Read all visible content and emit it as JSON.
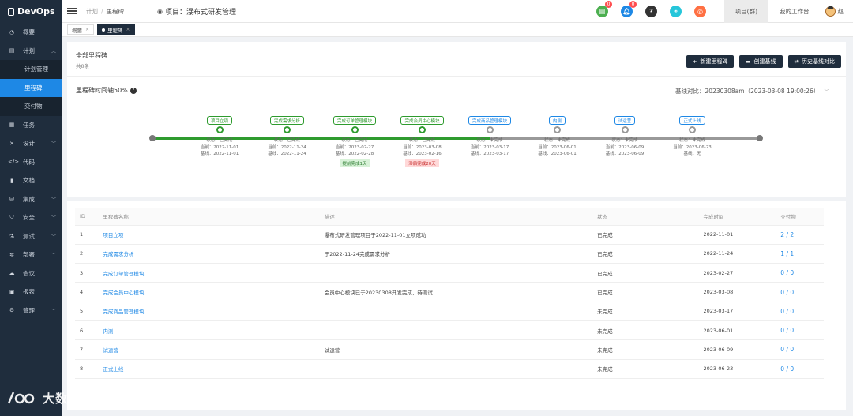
{
  "app": {
    "logo": "DevOps"
  },
  "sidebar": {
    "items": [
      {
        "icon": "dashboard-icon",
        "glyph": "◔",
        "label": "概要",
        "chev": false
      },
      {
        "icon": "plan-icon",
        "glyph": "▤",
        "label": "计划",
        "chev": true,
        "chev_dir": "up"
      },
      {
        "label": "计划管理",
        "sub": true
      },
      {
        "label": "里程碑",
        "sub": true,
        "active": true
      },
      {
        "label": "交付物",
        "sub": true
      },
      {
        "icon": "task-icon",
        "glyph": "▦",
        "label": "任务",
        "chev": false
      },
      {
        "icon": "design-icon",
        "glyph": "✕",
        "label": "设计",
        "chev": true
      },
      {
        "icon": "code-icon",
        "glyph": "</>",
        "label": "代码",
        "chev": false
      },
      {
        "icon": "doc-icon",
        "glyph": "▮",
        "label": "文档",
        "chev": false
      },
      {
        "icon": "integration-icon",
        "glyph": "⛁",
        "label": "集成",
        "chev": true
      },
      {
        "icon": "security-icon",
        "glyph": "⛉",
        "label": "安全",
        "chev": true
      },
      {
        "icon": "test-icon",
        "glyph": "⚗",
        "label": "测试",
        "chev": true
      },
      {
        "icon": "deploy-icon",
        "glyph": "✲",
        "label": "部署",
        "chev": true
      },
      {
        "icon": "meeting-icon",
        "glyph": "☁",
        "label": "会议",
        "chev": false
      },
      {
        "icon": "report-icon",
        "glyph": "▣",
        "label": "报表",
        "chev": false
      },
      {
        "icon": "admin-icon",
        "glyph": "⚙",
        "label": "管理",
        "chev": true
      }
    ]
  },
  "header": {
    "breadcrumb": [
      "计划",
      "里程碑"
    ],
    "project_prefix": "项目：",
    "project_name": "瀑布式研发管理",
    "icons": [
      {
        "name": "todo-icon",
        "color": "#4caf50",
        "glyph": "▤",
        "badge": "0"
      },
      {
        "name": "notification-bell-icon",
        "color": "#1e88e5",
        "glyph": "🔔︎",
        "badge": "0"
      },
      {
        "name": "help-icon",
        "color": "#333333",
        "glyph": "?",
        "badge": ""
      },
      {
        "name": "link-icon",
        "color": "#26c6da",
        "glyph": "⚭",
        "badge": ""
      },
      {
        "name": "settings-icon",
        "color": "#ff7043",
        "glyph": "◎",
        "badge": ""
      }
    ],
    "tabs": [
      {
        "label": "项目(群)",
        "active": true
      },
      {
        "label": "我的工作台",
        "active": false
      }
    ],
    "user": "赵"
  },
  "tabs_bar": [
    {
      "label": "概要",
      "active": false
    },
    {
      "label": "里程碑",
      "active": true
    }
  ],
  "milestones_card": {
    "title": "全部里程碑",
    "count": "共8条",
    "buttons": [
      {
        "icon": "plus-icon",
        "glyph": "+",
        "label": "新建里程碑"
      },
      {
        "icon": "baseline-icon",
        "glyph": "▬",
        "label": "创建基线"
      },
      {
        "icon": "history-icon",
        "glyph": "⇄",
        "label": "历史基线对比"
      }
    ],
    "timeline_title": "里程碑时间轴50%",
    "baseline_compare": "基线对比：20230308am（2023-03-08 19:00:26）",
    "colors": {
      "done": "#2e9b2e",
      "todo": "#1e88e5",
      "track_gray": "#999999"
    }
  },
  "timeline": [
    {
      "label": "项目立项",
      "done": true,
      "status": "状态：已完成",
      "current": "当前：2022-11-01",
      "base": "基线：2022-11-01",
      "flag": "",
      "flag_type": ""
    },
    {
      "label": "完成需求分析",
      "done": true,
      "status": "状态：已完成",
      "current": "当前：2022-11-24",
      "base": "基线：2022-11-24",
      "flag": "",
      "flag_type": ""
    },
    {
      "label": "完成订单管理模块",
      "done": true,
      "status": "状态：已完成",
      "current": "当前：2023-02-27",
      "base": "基线：2022-02-28",
      "flag": "提前完成1天",
      "flag_type": "green"
    },
    {
      "label": "完成会员中心模块",
      "done": true,
      "status": "状态：已完成",
      "current": "当前：2023-03-08",
      "base": "基线：2023-02-16",
      "flag": "滞后完成20天",
      "flag_type": "red"
    },
    {
      "label": "完成商品管理模块",
      "done": false,
      "status": "状态：未完成",
      "current": "当前：2023-03-17",
      "base": "基线：2023-03-17",
      "flag": "",
      "flag_type": ""
    },
    {
      "label": "内测",
      "done": false,
      "status": "状态：未完成",
      "current": "当前：2023-06-01",
      "base": "基线：2023-06-01",
      "flag": "",
      "flag_type": ""
    },
    {
      "label": "试运营",
      "done": false,
      "status": "状态：未完成",
      "current": "当前：2023-06-09",
      "base": "基线：2023-06-09",
      "flag": "",
      "flag_type": ""
    },
    {
      "label": "正式上线",
      "done": false,
      "status": "状态：未完成",
      "current": "当前：2023-06-23",
      "base": "基线：无",
      "flag": "",
      "flag_type": ""
    }
  ],
  "table": {
    "headers": [
      "ID",
      "里程碑名称",
      "描述",
      "状态",
      "完成时间",
      "交付物"
    ],
    "rows": [
      {
        "id": "1",
        "name": "项目立项",
        "desc": "瀑布式研发管理项目于2022-11-01立项成功",
        "status": "已完成",
        "time": "2022-11-01",
        "deliverables": "2 / 2"
      },
      {
        "id": "2",
        "name": "完成需求分析",
        "desc": "于2022-11-24完成需求分析",
        "status": "已完成",
        "time": "2022-11-24",
        "deliverables": "1 / 1"
      },
      {
        "id": "3",
        "name": "完成订单管理模块",
        "desc": "",
        "status": "已完成",
        "time": "2023-02-27",
        "deliverables": "0 / 0"
      },
      {
        "id": "4",
        "name": "完成会员中心模块",
        "desc": "会员中心模块已于20230308开发完成，待测试",
        "status": "已完成",
        "time": "2023-03-08",
        "deliverables": "0 / 0"
      },
      {
        "id": "5",
        "name": "完成商品管理模块",
        "desc": "",
        "status": "未完成",
        "time": "2023-03-17",
        "deliverables": "0 / 0"
      },
      {
        "id": "6",
        "name": "内测",
        "desc": "",
        "status": "未完成",
        "time": "2023-06-01",
        "deliverables": "0 / 0"
      },
      {
        "id": "7",
        "name": "试运营",
        "desc": "试运营",
        "status": "未完成",
        "time": "2023-06-09",
        "deliverables": "0 / 0"
      },
      {
        "id": "8",
        "name": "正式上线",
        "desc": "",
        "status": "未完成",
        "time": "2023-06-23",
        "deliverables": "0 / 0"
      }
    ]
  },
  "watermark": "大数跨境"
}
